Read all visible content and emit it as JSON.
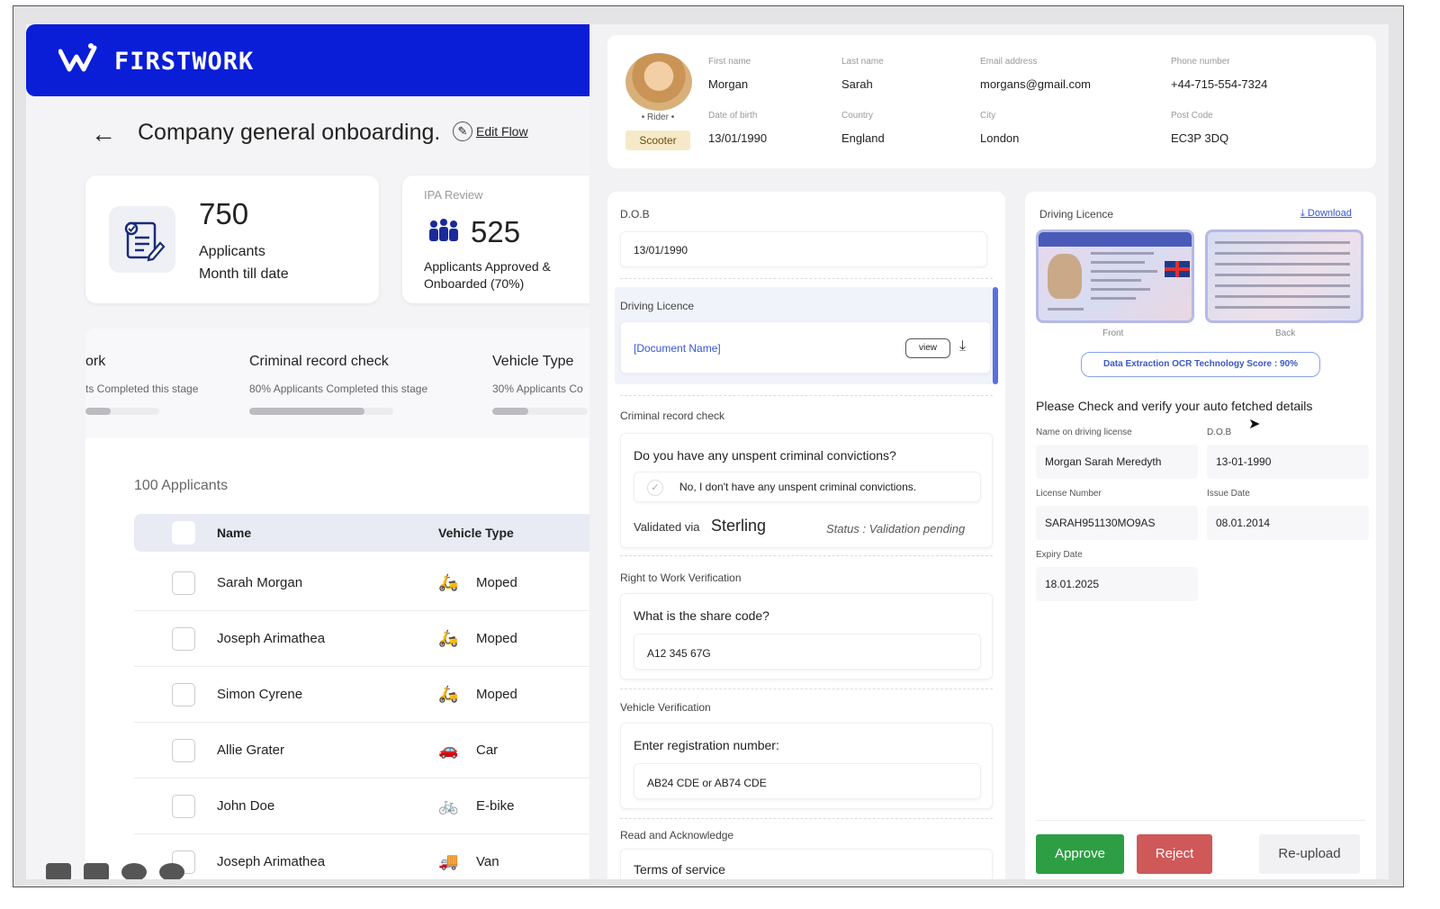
{
  "brand": {
    "name": "FIRSTWORK",
    "color": "#0a1ed8"
  },
  "header": {
    "title": "Company general onboarding.",
    "edit_flow": "Edit Flow"
  },
  "stats": [
    {
      "value": "750",
      "label_line1": "Applicants",
      "label_line2": "Month till date",
      "icon": "clipboard-checklist-icon"
    },
    {
      "subtitle": "IPA Review",
      "value": "525",
      "label_line1": "Applicants Approved &",
      "label_line2": "Onboarded (70%)",
      "icon": "people-group-icon"
    }
  ],
  "stages": [
    {
      "name": "ork",
      "progress": "ts Completed this stage",
      "fill": 0.2
    },
    {
      "name": "Criminal record check",
      "progress": "80% Applicants Completed this stage",
      "fill": 0.8
    },
    {
      "name": "Vehicle Type",
      "progress": "30% Applicants Co",
      "fill": 0.3
    }
  ],
  "table": {
    "count_label": "100 Applicants",
    "columns": [
      "Name",
      "Vehicle Type"
    ],
    "rows": [
      {
        "name": "Sarah Morgan",
        "vehicle": "Moped",
        "icon": "🛵"
      },
      {
        "name": "Joseph Arimathea",
        "vehicle": "Moped",
        "icon": "🛵"
      },
      {
        "name": "Simon Cyrene",
        "vehicle": "Moped",
        "icon": "🛵"
      },
      {
        "name": "Allie Grater",
        "vehicle": "Car",
        "icon": "🚗"
      },
      {
        "name": "John Doe",
        "vehicle": "E-bike",
        "icon": "🚲"
      },
      {
        "name": "Joseph Arimathea",
        "vehicle": "Van",
        "icon": "🚚"
      }
    ]
  },
  "profile": {
    "rider_label": "• Rider •",
    "badge": "Scooter",
    "fields": [
      {
        "key": "First name",
        "value": "Morgan"
      },
      {
        "key": "Last name",
        "value": "Sarah"
      },
      {
        "key": "Email address",
        "value": "morgans@gmail.com"
      },
      {
        "key": "Phone number",
        "value": "+44-715-554-7324"
      },
      {
        "key": "Date of birth",
        "value": "13/01/1990"
      },
      {
        "key": "Country",
        "value": "England"
      },
      {
        "key": "City",
        "value": "London"
      },
      {
        "key": "Post Code",
        "value": "EC3P 3DQ"
      }
    ]
  },
  "form": {
    "dob_label": "D.O.B",
    "dob_value": "13/01/1990",
    "dl_label": "Driving Licence",
    "doc_name": "[Document Name]",
    "view": "view",
    "crc_label": "Criminal record check",
    "crc_question": "Do you have any unspent criminal convictions?",
    "crc_answer": "No, I don't have any unspent criminal convictions.",
    "validated_via": "Validated via",
    "sterling": "Sterling",
    "status": "Status : Validation pending",
    "rtw_label": "Right to Work Verification",
    "rtw_question": "What is the share code?",
    "rtw_value": "A12 345 67G",
    "vv_label": "Vehicle Verification",
    "vv_question": "Enter registration number:",
    "vv_value": "AB24 CDE or AB74 CDE",
    "ra_label": "Read and Acknowledge",
    "ra_item": "Terms of service"
  },
  "licence": {
    "title": "Driving Licence",
    "download": "Download",
    "front": "Front",
    "back": "Back",
    "ocr": "Data Extraction OCR Technology Score : 90%",
    "verify_msg": "Please Check and verify your auto fetched details",
    "fields": [
      {
        "key": "Name on driving license",
        "value": "Morgan Sarah Meredyth"
      },
      {
        "key": "D.O.B",
        "value": "13-01-1990"
      },
      {
        "key": "License Number",
        "value": "SARAH951130MO9AS"
      },
      {
        "key": "Issue Date",
        "value": "08.01.2014"
      },
      {
        "key": "Expiry Date",
        "value": "18.01.2025"
      }
    ],
    "approve": "Approve",
    "reject": "Reject",
    "reupload": "Re-upload"
  }
}
